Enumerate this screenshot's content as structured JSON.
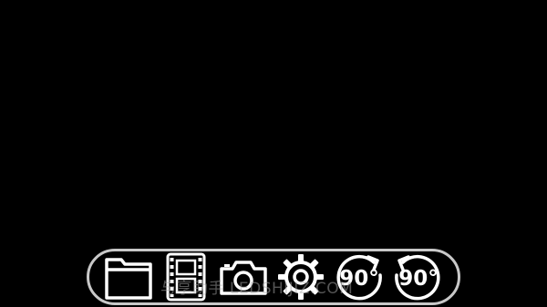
{
  "toolbar": {
    "buttons": [
      {
        "id": "folder",
        "icon": "folder-icon"
      },
      {
        "id": "video",
        "icon": "film-strip-icon"
      },
      {
        "id": "camera",
        "icon": "camera-icon"
      },
      {
        "id": "settings",
        "icon": "gear-icon"
      },
      {
        "id": "rotate_cw",
        "icon": "rotate-clockwise-icon",
        "label": "90°"
      },
      {
        "id": "rotate_ccw",
        "icon": "rotate-counterclockwise-icon",
        "label": "90°"
      }
    ]
  },
  "watermark": {
    "text": "与享助手 LEDSHIJIZ.COM"
  },
  "colors": {
    "background": "#000000",
    "toolbar_border": "#c8c8c8",
    "icon": "#ffffff"
  }
}
